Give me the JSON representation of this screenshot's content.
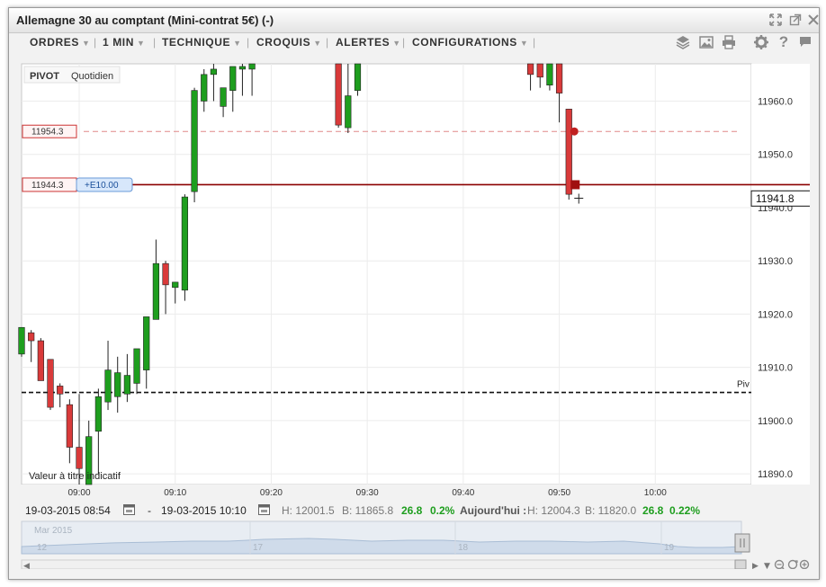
{
  "window": {
    "title": "Allemagne 30 au comptant (Mini-contrat 5€) (-)",
    "icons": [
      "move-icon",
      "popout-icon",
      "close-icon"
    ]
  },
  "toolbar": {
    "menus": [
      "ORDRES",
      "1 MIN",
      "TECHNIQUE",
      "CROQUIS",
      "ALERTES",
      "CONFIGURATIONS"
    ],
    "tools": [
      "layers-icon",
      "image-icon",
      "print-icon",
      "gear-icon",
      "help-icon",
      "flag-icon"
    ]
  },
  "chart": {
    "pivot_tag": "PIVOT",
    "pivot_period": "Quotidien",
    "watermark": "Valeur à titre indicatif",
    "pivot_line_label": "Piv",
    "level_label_1": "11954.3",
    "level_label_2": "11944.3",
    "order_tag": "+E10.00",
    "current_price": "11941.8",
    "colors": {
      "up": "#1e9e1e",
      "down": "#d93a3a",
      "order_line": "#8b0000",
      "alert_line": "#e08888"
    }
  },
  "chart_data": {
    "type": "candlestick",
    "x_tick_labels": [
      "09:00",
      "09:10",
      "09:20",
      "09:30",
      "09:40",
      "09:50",
      "10:00"
    ],
    "y_tick_labels": [
      "11960.0",
      "11950.0",
      "11940.0",
      "11930.0",
      "11920.0",
      "11910.0",
      "11900.0",
      "11890.0"
    ],
    "ylim": [
      11888,
      11967
    ],
    "xlim": [
      "08:54",
      "10:10"
    ],
    "pivot_level": 11905.3,
    "alert_level": 11954.3,
    "order_level": 11944.3,
    "last_price": 11941.8,
    "candles": [
      {
        "t": "08:54",
        "o": 11912.5,
        "h": 11917.5,
        "l": 11912.0,
        "c": 11917.5
      },
      {
        "t": "08:55",
        "o": 11916.5,
        "h": 11917.0,
        "l": 11911.0,
        "c": 11915.0
      },
      {
        "t": "08:56",
        "o": 11915.0,
        "h": 11915.5,
        "l": 11908.5,
        "c": 11907.5
      },
      {
        "t": "08:57",
        "o": 11911.5,
        "h": 11911.5,
        "l": 11902.0,
        "c": 11902.5
      },
      {
        "t": "08:58",
        "o": 11906.5,
        "h": 11907.0,
        "l": 11902.5,
        "c": 11905.0
      },
      {
        "t": "08:59",
        "o": 11903.0,
        "h": 11904.0,
        "l": 11892.0,
        "c": 11895.0
      },
      {
        "t": "09:00",
        "o": 11895.0,
        "h": 11905.0,
        "l": 11888.0,
        "c": 11891.0
      },
      {
        "t": "09:01",
        "o": 11885.0,
        "h": 11900.0,
        "l": 11880.0,
        "c": 11897.0
      },
      {
        "t": "09:02",
        "o": 11898.0,
        "h": 11906.0,
        "l": 11890.0,
        "c": 11904.5
      },
      {
        "t": "09:03",
        "o": 11903.5,
        "h": 11915.0,
        "l": 11902.0,
        "c": 11909.5
      },
      {
        "t": "09:04",
        "o": 11904.5,
        "h": 11912.0,
        "l": 11901.5,
        "c": 11909.0
      },
      {
        "t": "09:05",
        "o": 11905.0,
        "h": 11912.5,
        "l": 11903.5,
        "c": 11908.5
      },
      {
        "t": "09:06",
        "o": 11907.0,
        "h": 11911.5,
        "l": 11905.0,
        "c": 11913.5
      },
      {
        "t": "09:07",
        "o": 11909.5,
        "h": 11917.0,
        "l": 11906.0,
        "c": 11919.5
      },
      {
        "t": "09:08",
        "o": 11919.0,
        "h": 11934.0,
        "l": 11919.0,
        "c": 11929.5
      },
      {
        "t": "09:09",
        "o": 11929.5,
        "h": 11930.0,
        "l": 11920.0,
        "c": 11925.5
      },
      {
        "t": "09:10",
        "o": 11925.0,
        "h": 11926.0,
        "l": 11922.0,
        "c": 11926.0
      },
      {
        "t": "09:11",
        "o": 11924.5,
        "h": 11942.5,
        "l": 11922.5,
        "c": 11942.0
      },
      {
        "t": "09:12",
        "o": 11943.0,
        "h": 11962.5,
        "l": 11941.0,
        "c": 11962.0
      },
      {
        "t": "09:13",
        "o": 11960.0,
        "h": 11966.0,
        "l": 11958.0,
        "c": 11965.0
      },
      {
        "t": "09:14",
        "o": 11965.0,
        "h": 11967.0,
        "l": 11960.0,
        "c": 11966.0
      },
      {
        "t": "09:15",
        "o": 11959.0,
        "h": 11962.0,
        "l": 11957.0,
        "c": 11962.5
      },
      {
        "t": "09:16",
        "o": 11962.0,
        "h": 11966.0,
        "l": 11958.0,
        "c": 11966.5
      },
      {
        "t": "09:17",
        "o": 11966.0,
        "h": 11967.0,
        "l": 11961.0,
        "c": 11966.5
      },
      {
        "t": "09:18",
        "o": 11966.0,
        "h": 11967.0,
        "l": 11961.0,
        "c": 11967.0
      },
      {
        "t": "09:27",
        "o": 11967.0,
        "h": 11967.0,
        "l": 11955.0,
        "c": 11955.5
      },
      {
        "t": "09:28",
        "o": 11955.0,
        "h": 11967.0,
        "l": 11954.0,
        "c": 11961.0
      },
      {
        "t": "09:29",
        "o": 11962.0,
        "h": 11967.0,
        "l": 11961.0,
        "c": 11967.0
      },
      {
        "t": "09:47",
        "o": 11967.0,
        "h": 11967.0,
        "l": 11962.0,
        "c": 11965.0
      },
      {
        "t": "09:48",
        "o": 11967.0,
        "h": 11967.0,
        "l": 11962.5,
        "c": 11964.5
      },
      {
        "t": "09:49",
        "o": 11963.0,
        "h": 11967.0,
        "l": 11962.0,
        "c": 11967.0
      },
      {
        "t": "09:50",
        "o": 11967.0,
        "h": 11967.0,
        "l": 11956.0,
        "c": 11961.5
      },
      {
        "t": "09:51",
        "o": 11958.5,
        "h": 11958.5,
        "l": 11941.5,
        "c": 11942.5
      }
    ]
  },
  "bottom_bar": {
    "from_date": "19-03-2015 08:54",
    "dash": "-",
    "to_date": "19-03-2015 10:10",
    "h": "H: 12001.5",
    "b": "B: 11865.8",
    "change": "26.8",
    "change_pct": "0.2%",
    "today_label": "Aujourd'hui :",
    "today_h": "H: 12004.3",
    "today_b": "B: 11820.0",
    "today_change": "26.8",
    "today_change_pct": "0.22%"
  },
  "navigator": {
    "month_label": "Mar 2015",
    "day_labels": [
      "12",
      "17",
      "18",
      "19"
    ]
  }
}
